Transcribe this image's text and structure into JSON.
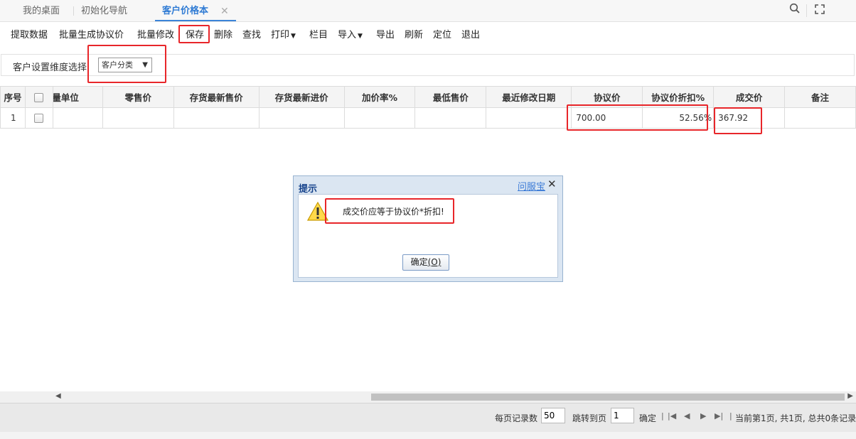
{
  "tabs": [
    {
      "label": "我的桌面"
    },
    {
      "label": "初始化导航"
    },
    {
      "label": "客户价格本"
    }
  ],
  "icons": {
    "search": "search-icon",
    "fullscreen": "fullscreen-icon",
    "close": "close-icon",
    "warning": "warning-icon"
  },
  "toolbar": {
    "extract": "提取数据",
    "batch_generate": "批量生成协议价",
    "batch_modify": "批量修改",
    "save": "保存",
    "delete": "删除",
    "find": "查找",
    "print": "打印",
    "columns": "栏目",
    "import": "导入",
    "export": "导出",
    "refresh": "刷新",
    "locate": "定位",
    "exit": "退出"
  },
  "filter": {
    "label": "客户设置维度选择",
    "selected": "客户分类"
  },
  "grid": {
    "headers": [
      "序号",
      "",
      "计量单位",
      "零售价",
      "存货最新售价",
      "存货最新进价",
      "加价率%",
      "最低售价",
      "最近修改日期",
      "协议价",
      "协议价折扣%",
      "成交价",
      "备注"
    ],
    "rows": [
      {
        "seq": "1",
        "unit": "",
        "retail": "",
        "latest_sale": "",
        "latest_purchase": "",
        "markup": "",
        "min_price": "",
        "modified": "",
        "agreement_price": "700.00",
        "discount": "52.56%",
        "deal_price": "367.92",
        "remark": ""
      }
    ]
  },
  "pager": {
    "per_page_label": "每页记录数",
    "per_page_value": "50",
    "goto_label": "跳转到页",
    "goto_value": "1",
    "confirm": "确定",
    "status": "当前第1页, 共1页, 总共0条记录"
  },
  "dialog": {
    "title": "提示",
    "help_link": "问服宝",
    "message": "成交价应等于协议价*折扣!",
    "ok_label": "确定",
    "ok_shortcut": "(O)"
  },
  "colors": {
    "accent": "#3b84d8",
    "highlight": "#e8262a",
    "dialog_title": "#15428b"
  }
}
